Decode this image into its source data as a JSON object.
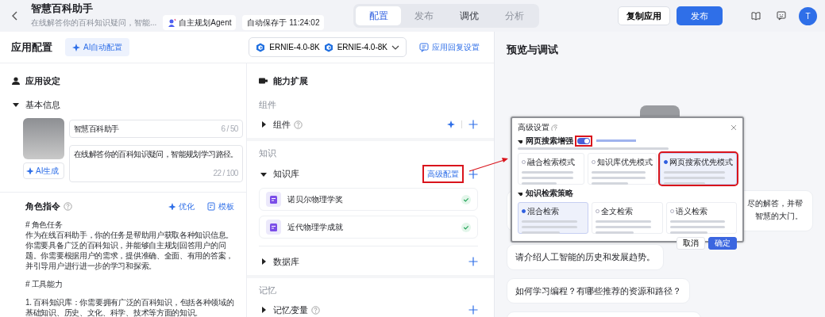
{
  "header": {
    "title": "智慧百科助手",
    "subtitle": "在线解答你的百科知识疑问，智能...",
    "agent_badge": "自主规划Agent",
    "autosave": "自动保存于 11:24:02",
    "tabs": [
      {
        "label": "配置",
        "selected": true,
        "disabled": false
      },
      {
        "label": "发布",
        "selected": false,
        "disabled": true
      },
      {
        "label": "调优",
        "selected": false,
        "disabled": false
      },
      {
        "label": "分析",
        "selected": false,
        "disabled": true
      }
    ],
    "copy_button": "复制应用",
    "publish_button": "发布",
    "avatar_letter": "T"
  },
  "toolbar": {
    "title": "应用配置",
    "ai_button": "AI自动配置",
    "models": [
      "ERNIE-4.0-8K",
      "ERNIE-4.0-8K"
    ],
    "reply_settings": "应用回复设置"
  },
  "settings": {
    "title": "应用设定",
    "basic_info": {
      "label": "基本信息",
      "expanded": true,
      "ai_generate": "AI生成",
      "name": {
        "value": "智慧百科助手",
        "counter": "6 / 50"
      },
      "description": {
        "value": "在线解答你的百科知识疑问，智能规划学习路径。",
        "counter": "22 / 100"
      }
    },
    "role": {
      "label": "角色指令",
      "optimize": "优化",
      "template": "模板",
      "paragraphs": [
        [
          "# 角色任务",
          "作为在线百科助手，你的任务是帮助用户获取各种知识信息。你需要具备广泛的百科知识，并能够自主规划回答用户的问题。你需要根据用户的需求，提供准确、全面、有用的答案，并引导用户进行进一步的学习和探索。"
        ],
        [
          "# 工具能力"
        ],
        [
          "1. 百科知识库：你需要拥有广泛的百科知识，包括各种领域的基础知识、历史、文化、科学、技术等方面的知识。"
        ]
      ]
    }
  },
  "abilities": {
    "title": "能力扩展",
    "groups": [
      {
        "label": "组件",
        "sections": [
          {
            "name": "组件",
            "help": true,
            "expanded": false,
            "ai_button": true
          }
        ]
      },
      {
        "label": "知识",
        "sections": [
          {
            "name": "知识库",
            "help": false,
            "expanded": true,
            "ai_button": false,
            "advanced_link": {
              "label": "高级配置",
              "highlighted": true
            },
            "items": [
              {
                "name": "诺贝尔物理学奖",
                "checked": true
              },
              {
                "name": "近代物理学成就",
                "checked": true
              }
            ]
          },
          {
            "name": "数据库",
            "help": false,
            "expanded": false,
            "ai_button": false
          }
        ]
      },
      {
        "label": "记忆",
        "sections": [
          {
            "name": "记忆变量",
            "help": true,
            "expanded": false,
            "ai_button": false
          }
        ]
      }
    ]
  },
  "preview": {
    "title": "预览与调试",
    "reply_fragment": [
      "尽的解答，并帮",
      "智慧的大门。"
    ],
    "suggestions": [
      "请介绍人工智能的历史和发展趋势。",
      "如何学习编程？有哪些推荐的资源和路径？"
    ]
  },
  "dialog": {
    "title": "高级设置",
    "web_search": {
      "label": "网页搜索增强",
      "on": true,
      "highlighted": true
    },
    "modes": [
      {
        "label": "融合检索模式",
        "selected": false,
        "highlighted": false
      },
      {
        "label": "知识库优先模式",
        "selected": false,
        "highlighted": false
      },
      {
        "label": "网页搜索优先模式",
        "selected": true,
        "highlighted": true
      }
    ],
    "strategy_title": "知识检索策略",
    "strategies": [
      {
        "label": "混合检索",
        "selected": true,
        "highlighted": false
      },
      {
        "label": "全文检索",
        "selected": false,
        "highlighted": false
      },
      {
        "label": "语义检索",
        "selected": false,
        "highlighted": false
      }
    ],
    "cancel": "取消",
    "confirm": "确定"
  }
}
